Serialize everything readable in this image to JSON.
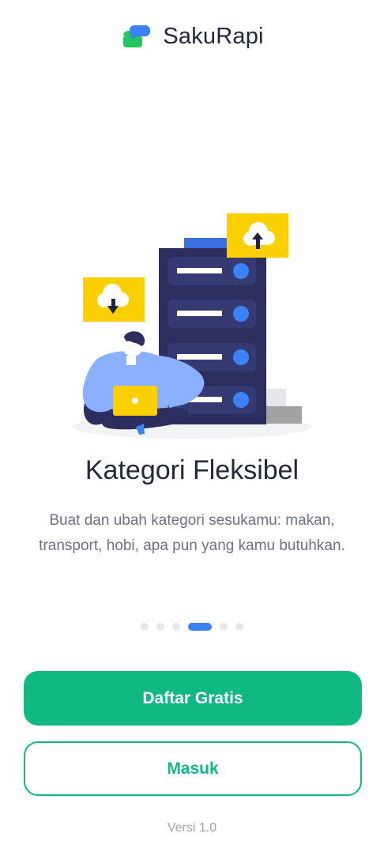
{
  "app": {
    "name": "SakuRapi",
    "logo_icon": "wallet-logo-icon",
    "colors": {
      "primary": "#10b981",
      "accent": "#3b82f6",
      "text": "#1f2937",
      "muted": "#6b7280"
    }
  },
  "onboarding": {
    "illustration": "person-laptop-server-cloud-illustration",
    "title": "Kategori Fleksibel",
    "description": "Buat dan ubah kategori sesukamu: makan, transport, hobi, apa pun yang kamu butuhkan.",
    "pager": {
      "total": 6,
      "active_index": 3
    }
  },
  "actions": {
    "register_label": "Daftar Gratis",
    "login_label": "Masuk"
  },
  "footer": {
    "version": "Versi 1.0"
  }
}
